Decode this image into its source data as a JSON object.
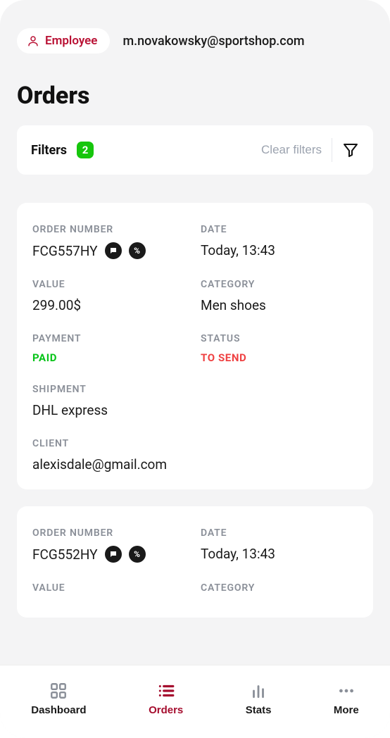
{
  "header": {
    "role_label": "Employee",
    "email": "m.novakowsky@sportshop.com"
  },
  "page_title": "Orders",
  "filters": {
    "label": "Filters",
    "count": "2",
    "clear_label": "Clear filters"
  },
  "labels": {
    "order_number": "ORDER NUMBER",
    "date": "DATE",
    "value": "VALUE",
    "category": "CATEGORY",
    "payment": "PAYMENT",
    "status": "STATUS",
    "shipment": "SHIPMENT",
    "client": "CLIENT"
  },
  "orders": [
    {
      "order_number": "FCG557HY",
      "date": "Today, 13:43",
      "value": "299.00$",
      "category": "Men shoes",
      "payment": "PAID",
      "status": "TO SEND",
      "shipment": "DHL express",
      "client": "alexisdale@gmail.com"
    },
    {
      "order_number": "FCG552HY",
      "date": "Today, 13:43",
      "value": "",
      "category": ""
    }
  ],
  "nav": {
    "dashboard": "Dashboard",
    "orders": "Orders",
    "stats": "Stats",
    "more": "More"
  }
}
